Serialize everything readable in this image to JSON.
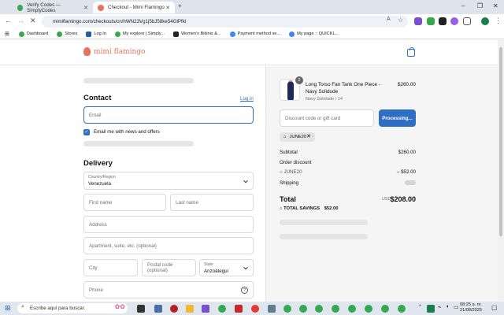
{
  "browser": {
    "tabs": [
      {
        "label": "Verify Codes — SimplyCodes",
        "active": false
      },
      {
        "label": "Checkout - Mimi Flamingo",
        "active": true
      }
    ],
    "new_tab": "+",
    "url": "mimiflamingo.com/checkouts/cn/hWN23Vg1j5bJ58ke54GlPfkl",
    "bookmarks": [
      "Dashboard",
      "Stores",
      "Log In",
      "My explore | Simply...",
      "Women's Bikinis &...",
      "Payment method se...",
      "My page :: QUICKL..."
    ]
  },
  "store": {
    "name": "mimi flamingo"
  },
  "contact": {
    "heading": "Contact",
    "login_link": "Log in",
    "email_placeholder": "Email",
    "newsletter_label": "Email me with news and offers"
  },
  "delivery": {
    "heading": "Delivery",
    "country_label": "Country/Region",
    "country_value": "Venezuela",
    "first_name_placeholder": "First name",
    "last_name_placeholder": "Last name",
    "address_placeholder": "Address",
    "apartment_placeholder": "Apartment, suite, etc. (optional)",
    "city_placeholder": "City",
    "postal_placeholder": "Postal code (optional)",
    "state_label": "State",
    "state_value": "Anzoátegui",
    "phone_placeholder": "Phone"
  },
  "summary": {
    "product_name": "Long Torso Fan Tank One Piece - Navy Solidude",
    "product_variant": "Navy Solidude / 14",
    "product_price": "$260.00",
    "quantity": "2",
    "discount_placeholder": "Discount code or gift card",
    "apply_button": "Processing...",
    "code_chip": "JUNE20",
    "subtotal_label": "Subtotal",
    "subtotal_value": "$260.00",
    "order_discount_label": "Order discount",
    "discount_code": "JUNE20",
    "discount_value": "– $52.00",
    "shipping_label": "Shipping",
    "total_label": "Total",
    "currency": "USD",
    "total_value": "$208.00",
    "savings_label": "TOTAL SAVINGS",
    "savings_value": "$52.00"
  },
  "taskbar": {
    "search_placeholder": "Escribe aquí para buscar.",
    "time": "08:25 a. m.",
    "date": "21/08/2025"
  },
  "colors": {
    "accent": "#2f6fc3",
    "brand": "#e8725c"
  }
}
